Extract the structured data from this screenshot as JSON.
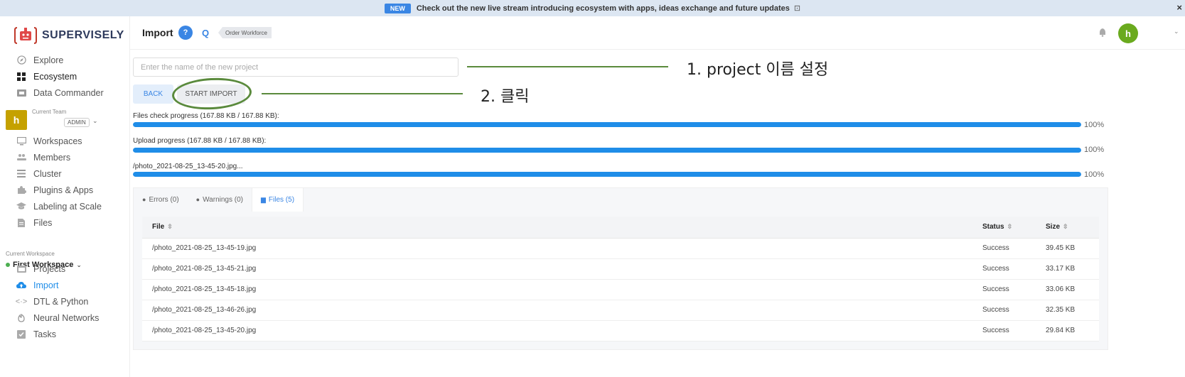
{
  "banner": {
    "badge": "NEW",
    "text": "Check out the new live stream introducing ecosystem with apps, ideas exchange and future updates",
    "close": "×"
  },
  "logo": {
    "text": "SUPERVISELY"
  },
  "sidebar": {
    "top_items": [
      {
        "label": "Explore",
        "icon": "compass-icon"
      },
      {
        "label": "Ecosystem",
        "icon": "grid-icon"
      },
      {
        "label": "Data Commander",
        "icon": "folder-icon"
      }
    ],
    "team": {
      "label": "Current Team",
      "avatar": "h",
      "role": "ADMIN"
    },
    "team_items": [
      {
        "label": "Workspaces",
        "icon": "monitor-icon"
      },
      {
        "label": "Members",
        "icon": "users-icon"
      },
      {
        "label": "Cluster",
        "icon": "server-icon"
      },
      {
        "label": "Plugins & Apps",
        "icon": "puzzle-icon"
      },
      {
        "label": "Labeling at Scale",
        "icon": "graduation-icon"
      },
      {
        "label": "Files",
        "icon": "file-icon"
      }
    ],
    "workspace": {
      "label": "Current Workspace",
      "name": "First Workspace"
    },
    "ws_items": [
      {
        "label": "Projects",
        "icon": "projects-icon"
      },
      {
        "label": "Import",
        "icon": "cloud-upload-icon"
      },
      {
        "label": "DTL & Python",
        "icon": "code-icon"
      },
      {
        "label": "Neural Networks",
        "icon": "brain-icon"
      },
      {
        "label": "Tasks",
        "icon": "tasks-icon"
      }
    ]
  },
  "header": {
    "title": "Import",
    "help": "?",
    "order": "Order Workforce",
    "avatar": "h"
  },
  "form": {
    "placeholder": "Enter the name of the new project",
    "back": "BACK",
    "start": "START IMPORT"
  },
  "annotations": {
    "a1": "1. project 이름 설정",
    "a2": "2. 클릭"
  },
  "progress": [
    {
      "label": "Files check progress (167.88 KB / 167.88 KB):",
      "value": 100,
      "pct": "100%"
    },
    {
      "label": "Upload progress (167.88 KB / 167.88 KB):",
      "value": 100,
      "pct": "100%"
    },
    {
      "label": "/photo_2021-08-25_13-45-20.jpg...",
      "value": 100,
      "pct": "100%"
    }
  ],
  "tabs": [
    {
      "label": "Errors (0)",
      "icon": "alert-icon"
    },
    {
      "label": "Warnings (0)",
      "icon": "warning-icon"
    },
    {
      "label": "Files (5)",
      "icon": "file-icon"
    }
  ],
  "table": {
    "headers": [
      "File",
      "Status",
      "Size"
    ],
    "rows": [
      [
        "/photo_2021-08-25_13-45-19.jpg",
        "Success",
        "39.45 KB"
      ],
      [
        "/photo_2021-08-25_13-45-21.jpg",
        "Success",
        "33.17 KB"
      ],
      [
        "/photo_2021-08-25_13-45-18.jpg",
        "Success",
        "33.06 KB"
      ],
      [
        "/photo_2021-08-25_13-46-26.jpg",
        "Success",
        "32.35 KB"
      ],
      [
        "/photo_2021-08-25_13-45-20.jpg",
        "Success",
        "29.84 KB"
      ]
    ]
  },
  "colors": {
    "accent": "#1f8de8",
    "annotation": "#5a8a3c",
    "team_avatar": "#c5a100",
    "user_avatar": "#6aaa1e"
  }
}
